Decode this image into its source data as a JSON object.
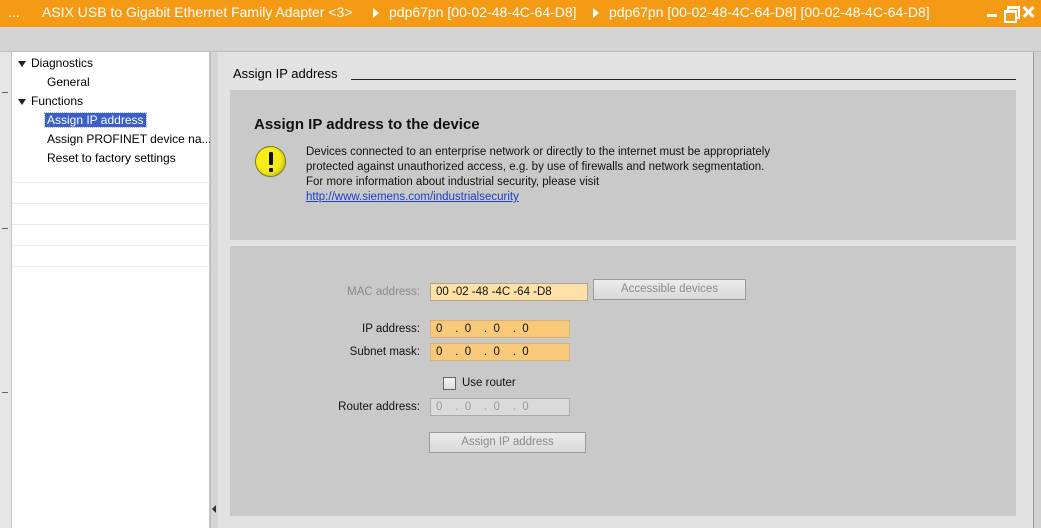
{
  "titlebar": {
    "ellipsis": "...",
    "crumbs": [
      "ASIX USB to Gigabit Ethernet Family Adapter <3>",
      "pdp67pn [00-02-48-4C-64-D8]",
      "pdp67pn [00-02-48-4C-64-D8] [00-02-48-4C-64-D8]"
    ],
    "icons": [
      "minimize-icon",
      "restore-icon",
      "close-icon"
    ],
    "color": "#f59a15"
  },
  "nav": {
    "groups": [
      {
        "label": "Diagnostics",
        "items": [
          "General"
        ]
      },
      {
        "label": "Functions",
        "items": [
          "Assign IP address",
          "Assign PROFINET device na...",
          "Reset to factory settings"
        ]
      }
    ],
    "selected": "Assign IP address",
    "selected_color": "#3a5fc7"
  },
  "section": {
    "title": "Assign IP address"
  },
  "info": {
    "heading": "Assign IP address to the device",
    "warning_lines": [
      "Devices connected to an enterprise network or directly to the internet must be appropriately",
      "protected against unauthorized access, e.g. by use of firewalls and network segmentation.",
      "For more information about industrial security, please visit"
    ],
    "link": "http://www.siemens.com/industrialsecurity",
    "icon": "warning-icon"
  },
  "form": {
    "mac_label": "MAC address:",
    "mac_value": "00 -02 -48 -4C -64 -D8",
    "accessible_devices_label": "Accessible devices",
    "ip_label": "IP address:",
    "ip_value": "0    .  0    .  0    .  0",
    "subnet_label": "Subnet mask:",
    "subnet_value": "0    .  0    .  0    .  0",
    "use_router_label": "Use router",
    "use_router_checked": false,
    "router_label": "Router address:",
    "router_value": "0    .  0    .  0    .  0",
    "assign_button_label": "Assign IP address"
  }
}
